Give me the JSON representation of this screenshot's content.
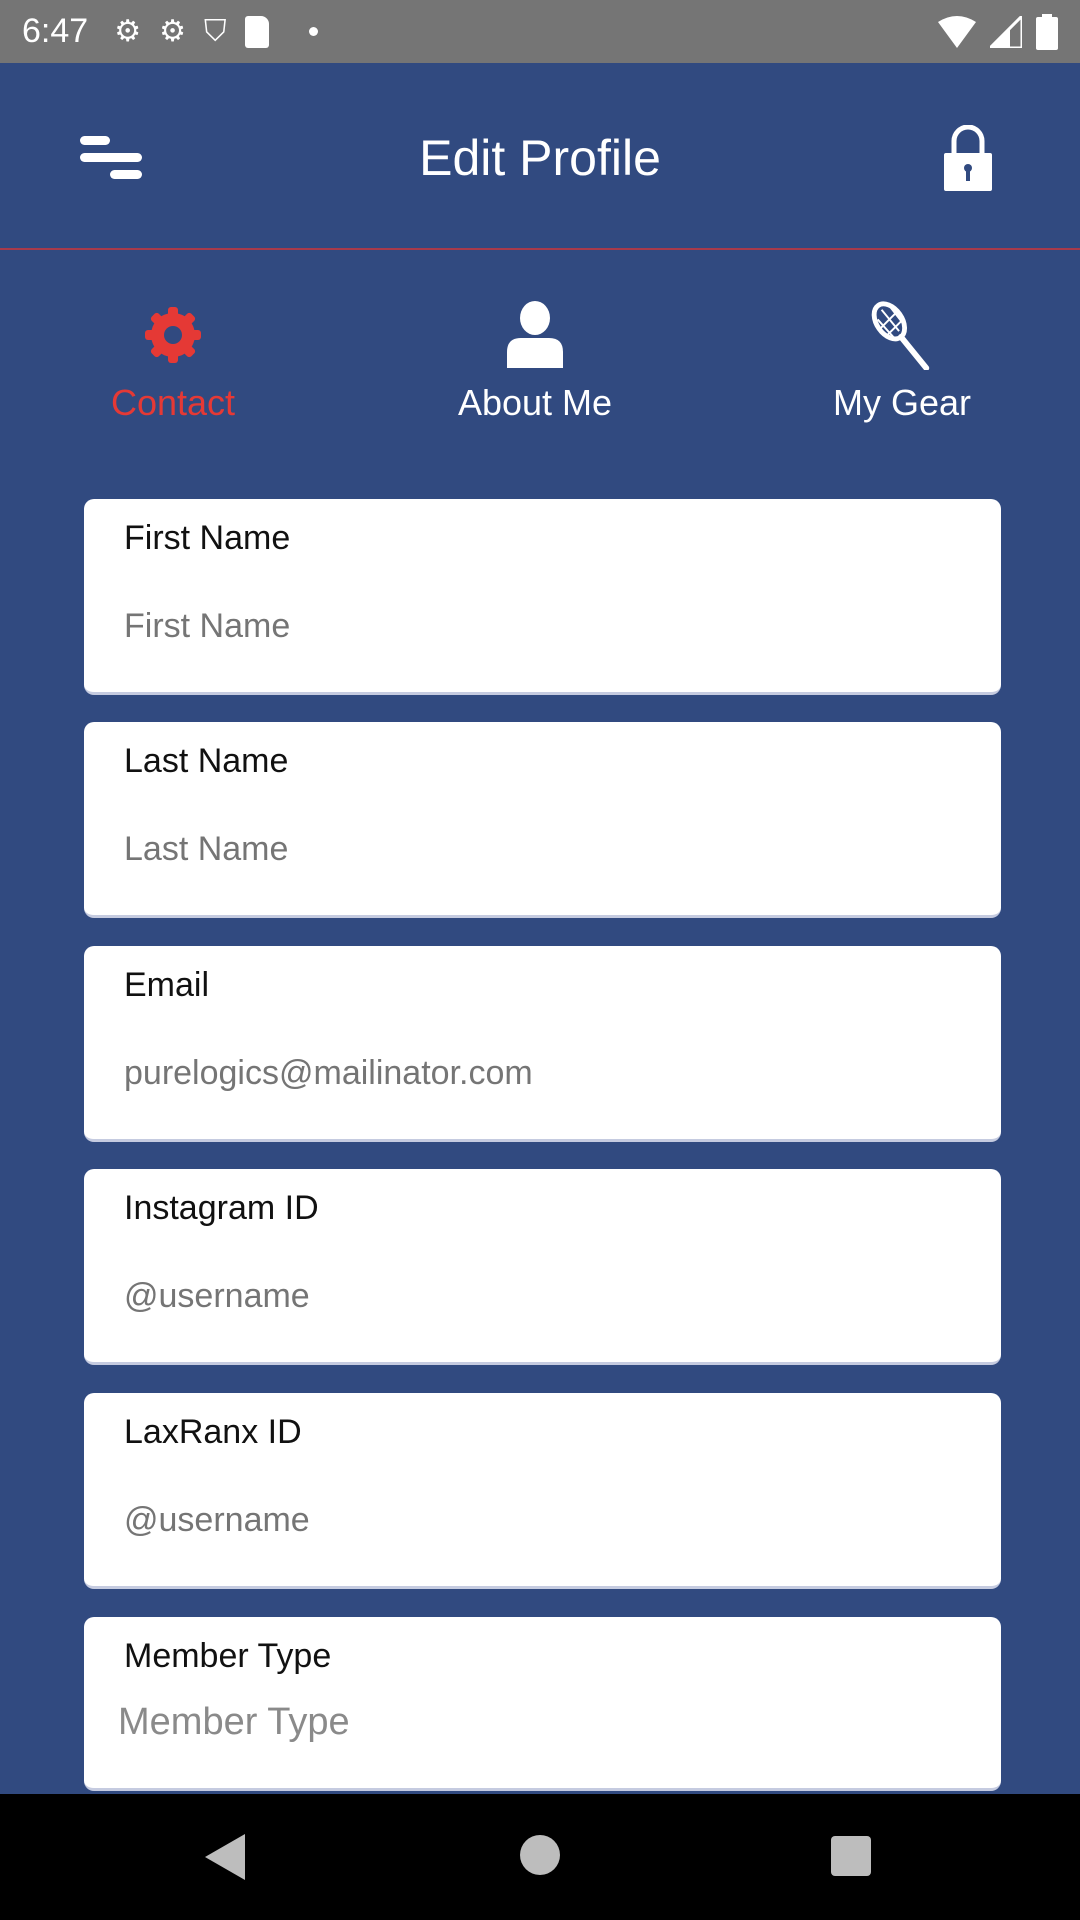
{
  "status_bar": {
    "time": "6:47",
    "icons": [
      "gear-icon",
      "gear-icon",
      "shield-play-icon",
      "sd-card-icon",
      "dot-icon",
      "wifi-icon",
      "signal-icon",
      "battery-icon"
    ]
  },
  "header": {
    "title": "Edit Profile",
    "menu_icon": "menu-icon",
    "lock_icon": "lock-icon"
  },
  "tabs": [
    {
      "label": "Contact",
      "icon": "gear-icon",
      "active": true
    },
    {
      "label": "About Me",
      "icon": "person-icon",
      "active": false
    },
    {
      "label": "My Gear",
      "icon": "lacrosse-stick-icon",
      "active": false
    }
  ],
  "fields": [
    {
      "label": "First Name",
      "placeholder": "First Name"
    },
    {
      "label": "Last Name",
      "placeholder": "Last Name"
    },
    {
      "label": "Email",
      "value": "purelogics@mailinator.com"
    },
    {
      "label": "Instagram ID",
      "placeholder": "@username"
    },
    {
      "label": "LaxRanx ID",
      "placeholder": "@username"
    },
    {
      "label": "Member Type",
      "placeholder": "Member Type"
    }
  ],
  "colors": {
    "background": "#314a80",
    "accent": "#e53935"
  }
}
